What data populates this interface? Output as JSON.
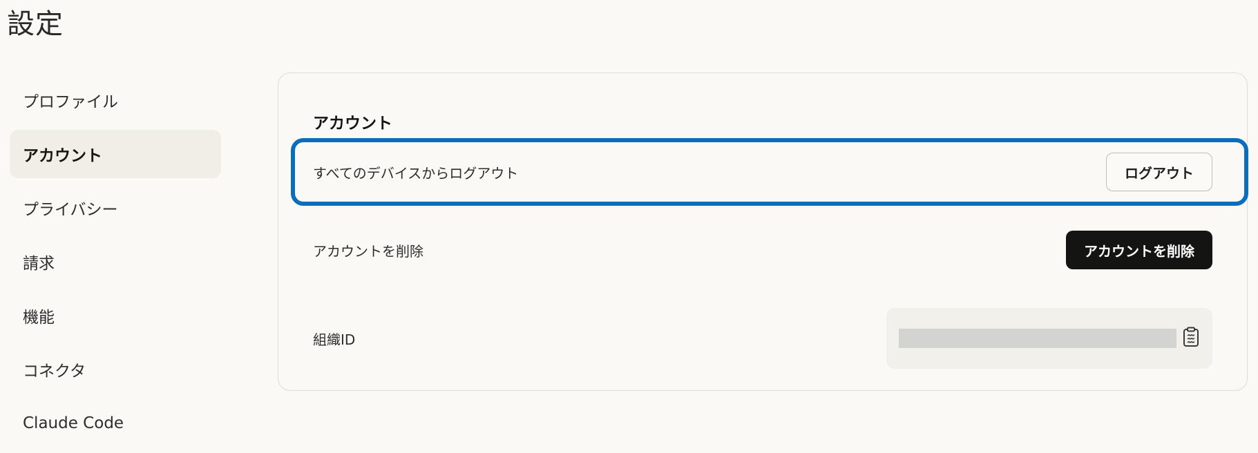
{
  "page": {
    "title": "設定"
  },
  "sidebar": {
    "items": [
      {
        "label": "プロファイル",
        "active": false
      },
      {
        "label": "アカウント",
        "active": true
      },
      {
        "label": "プライバシー",
        "active": false
      },
      {
        "label": "請求",
        "active": false
      },
      {
        "label": "機能",
        "active": false
      },
      {
        "label": "コネクタ",
        "active": false
      },
      {
        "label": "Claude Code",
        "active": false
      }
    ]
  },
  "account": {
    "section_title": "アカウント",
    "logout_all": {
      "label": "すべてのデバイスからログアウト",
      "button": "ログアウト"
    },
    "delete_account": {
      "label": "アカウントを削除",
      "button": "アカウントを削除"
    },
    "org_id": {
      "label": "組織ID",
      "value_redacted": true,
      "copy_icon": "clipboard-icon"
    }
  },
  "colors": {
    "background": "#faf9f5",
    "sidebar_active_bg": "#f0eee7",
    "highlight_border": "#0a6ebd",
    "dark_button": "#141413"
  }
}
